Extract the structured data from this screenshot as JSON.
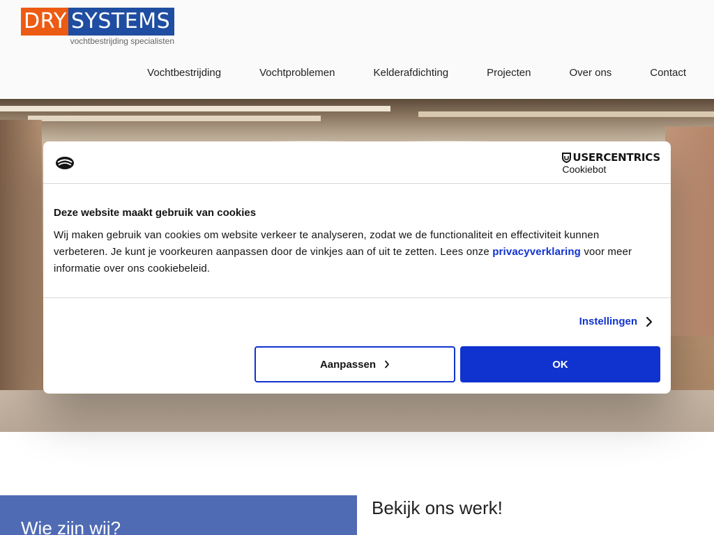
{
  "header": {
    "logo": {
      "word1": "DRY",
      "word2": "SYSTEMS",
      "tagline": "vochtbestrijding specialisten"
    },
    "nav": [
      {
        "label": "Vochtbestrijding"
      },
      {
        "label": "Vochtproblemen"
      },
      {
        "label": "Kelderafdichting"
      },
      {
        "label": "Projecten"
      },
      {
        "label": "Over ons"
      },
      {
        "label": "Contact"
      }
    ]
  },
  "cookie_dialog": {
    "brand_line1": "USERCENTRICS",
    "brand_line2": "Cookiebot",
    "title": "Deze website maakt gebruik van cookies",
    "text_before_link": "Wij maken gebruik van cookies om website verkeer te analyseren, zodat we de functionaliteit en effectiviteit kunnen verbeteren. Je kunt je voorkeuren aanpassen door de vinkjes aan of uit te zetten. Lees onze ",
    "link_label": "privacyverklaring",
    "text_after_link": " voor meer informatie over ons cookiebeleid.",
    "settings_label": "Instellingen",
    "customize_label": "Aanpassen",
    "ok_label": "OK",
    "colors": {
      "accent": "#1032cf"
    }
  },
  "sections": {
    "who_title": "Wie zijn wij?",
    "work_title": "Bekijk ons werk!"
  },
  "colors": {
    "logo_orange": "#ec5b13",
    "logo_blue": "#1f4da1",
    "who_bg": "#4f6bb4"
  }
}
